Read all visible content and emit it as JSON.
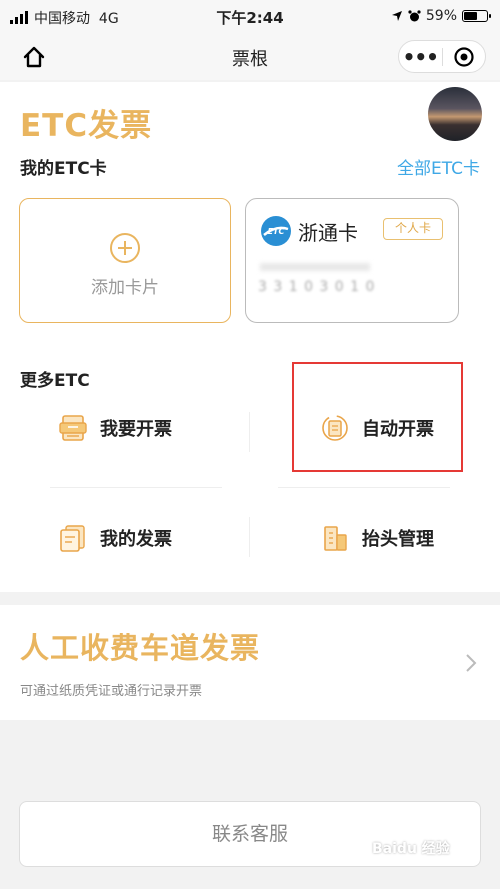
{
  "status": {
    "carrier": "中国移动",
    "network": "4G",
    "time": "下午2:44",
    "battery_percent": "59%",
    "battery_level": 0.59
  },
  "nav": {
    "title": "票根",
    "more_glyph": "•••",
    "home_icon": "home-icon",
    "close_icon": "target-close-icon"
  },
  "etc": {
    "title": "ETC发票",
    "my_cards_label": "我的ETC卡",
    "all_cards_link": "全部ETC卡",
    "add_card_label": "添加卡片",
    "card": {
      "name": "浙通卡",
      "badge": "个人卡",
      "number_masked": "3 3 1 0    3 0 1 0"
    },
    "more_label": "更多ETC",
    "menu": [
      {
        "label": "我要开票",
        "icon": "invoice-printer-icon"
      },
      {
        "label": "自动开票",
        "icon": "auto-invoice-icon"
      },
      {
        "label": "我的发票",
        "icon": "my-invoice-icon"
      },
      {
        "label": "抬头管理",
        "icon": "building-icon"
      }
    ]
  },
  "manual": {
    "title": "人工收费车道发票",
    "subtitle": "可通过纸质凭证或通行记录开票"
  },
  "contact_label": "联系客服",
  "watermark": "Baidu 经验",
  "colors": {
    "accent": "#e9b55f",
    "link": "#3fa8e6",
    "highlight": "#e53935"
  }
}
